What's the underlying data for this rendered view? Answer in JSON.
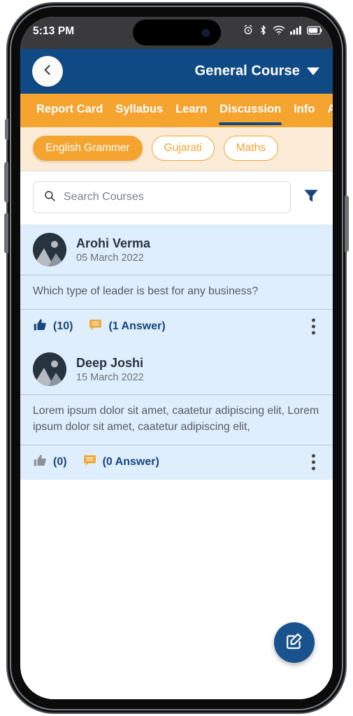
{
  "status_bar": {
    "time": "5:13 PM",
    "icons": [
      "alarm-icon",
      "bluetooth-icon",
      "wifi-icon",
      "cellular-signal-icon",
      "battery-icon"
    ]
  },
  "app_bar": {
    "back_icon": "chevron-left-icon",
    "title": "General Course",
    "dropdown_icon": "chevron-down-icon"
  },
  "tabs": [
    {
      "label": "Report Card",
      "active": false
    },
    {
      "label": "Syllabus",
      "active": false
    },
    {
      "label": "Learn",
      "active": false
    },
    {
      "label": "Discussion",
      "active": true
    },
    {
      "label": "Info",
      "active": false
    },
    {
      "label": "Annou",
      "active": false
    }
  ],
  "subject_chips": [
    {
      "label": "English Grammer",
      "active": true
    },
    {
      "label": "Gujarati",
      "active": false
    },
    {
      "label": "Maths",
      "active": false
    }
  ],
  "search": {
    "placeholder": "Search Courses",
    "value": "",
    "icon": "search-icon",
    "filter_icon": "filter-funnel-icon"
  },
  "posts": [
    {
      "author": "Arohi Verma",
      "date": "05 March 2022",
      "body": "Which type of leader is best for any business?",
      "likes_label": "(10)",
      "answers_label": "(1 Answer)",
      "liked": true,
      "like_icon": "thumbs-up-icon",
      "answer_icon": "comment-icon",
      "menu_icon": "more-vertical-icon"
    },
    {
      "author": "Deep Joshi",
      "date": "15 March 2022",
      "body": "Lorem ipsum dolor sit amet, caatetur adipiscing elit, Lorem ipsum dolor sit amet, caatetur adipiscing elit,",
      "likes_label": "(0)",
      "answers_label": "(0 Answer)",
      "liked": false,
      "like_icon": "thumbs-up-icon",
      "answer_icon": "comment-icon",
      "menu_icon": "more-vertical-icon"
    }
  ],
  "fab": {
    "icon": "compose-edit-icon"
  },
  "colors": {
    "header_blue": "#104a85",
    "tab_orange": "#f5a430",
    "chip_bar_bg": "#fcecd7",
    "post_bg": "#dfeefc",
    "action_blue": "#17457e",
    "fab_blue": "#19538d",
    "muted_gray": "#8a9197"
  }
}
